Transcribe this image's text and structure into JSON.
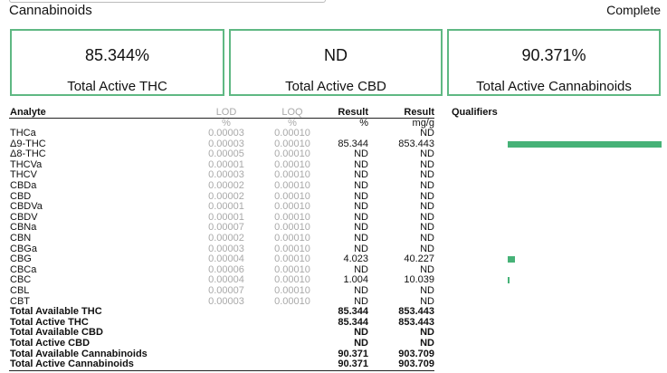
{
  "section_title": "Cannabinoids",
  "status": "Complete",
  "cards": [
    {
      "value": "85.344%",
      "caption": "Total Active THC"
    },
    {
      "value": "ND",
      "caption": "Total Active CBD"
    },
    {
      "value": "90.371%",
      "caption": "Total Active Cannabinoids"
    }
  ],
  "table": {
    "headers": {
      "analyte": "Analyte",
      "lod": "LOD",
      "loq": "LOQ",
      "result_pct": "Result",
      "result_mg": "Result",
      "qualifiers": "Qualifiers"
    },
    "units": {
      "lod": "%",
      "loq": "%",
      "result_pct": "%",
      "result_mg": "mg/g"
    },
    "rows": [
      {
        "analyte": "THCa",
        "lod": "0.00003",
        "loq": "0.00010",
        "pct": "",
        "mg": "ND",
        "bar": 0
      },
      {
        "analyte": "Δ9-THC",
        "lod": "0.00003",
        "loq": "0.00010",
        "pct": "85.344",
        "mg": "853.443",
        "bar": 85.344
      },
      {
        "analyte": "Δ8-THC",
        "lod": "0.00005",
        "loq": "0.00010",
        "pct": "ND",
        "mg": "ND",
        "bar": 0
      },
      {
        "analyte": "THCVa",
        "lod": "0.00001",
        "loq": "0.00010",
        "pct": "ND",
        "mg": "ND",
        "bar": 0
      },
      {
        "analyte": "THCV",
        "lod": "0.00003",
        "loq": "0.00010",
        "pct": "ND",
        "mg": "ND",
        "bar": 0
      },
      {
        "analyte": "CBDa",
        "lod": "0.00002",
        "loq": "0.00010",
        "pct": "ND",
        "mg": "ND",
        "bar": 0
      },
      {
        "analyte": "CBD",
        "lod": "0.00002",
        "loq": "0.00010",
        "pct": "ND",
        "mg": "ND",
        "bar": 0
      },
      {
        "analyte": "CBDVa",
        "lod": "0.00001",
        "loq": "0.00010",
        "pct": "ND",
        "mg": "ND",
        "bar": 0
      },
      {
        "analyte": "CBDV",
        "lod": "0.00001",
        "loq": "0.00010",
        "pct": "ND",
        "mg": "ND",
        "bar": 0
      },
      {
        "analyte": "CBNa",
        "lod": "0.00007",
        "loq": "0.00010",
        "pct": "ND",
        "mg": "ND",
        "bar": 0
      },
      {
        "analyte": "CBN",
        "lod": "0.00002",
        "loq": "0.00010",
        "pct": "ND",
        "mg": "ND",
        "bar": 0
      },
      {
        "analyte": "CBGa",
        "lod": "0.00003",
        "loq": "0.00010",
        "pct": "ND",
        "mg": "ND",
        "bar": 0
      },
      {
        "analyte": "CBG",
        "lod": "0.00004",
        "loq": "0.00010",
        "pct": "4.023",
        "mg": "40.227",
        "bar": 4.023
      },
      {
        "analyte": "CBCa",
        "lod": "0.00006",
        "loq": "0.00010",
        "pct": "ND",
        "mg": "ND",
        "bar": 0
      },
      {
        "analyte": "CBC",
        "lod": "0.00004",
        "loq": "0.00010",
        "pct": "1.004",
        "mg": "10.039",
        "bar": 1.004
      },
      {
        "analyte": "CBL",
        "lod": "0.00007",
        "loq": "0.00010",
        "pct": "ND",
        "mg": "ND",
        "bar": 0
      },
      {
        "analyte": "CBT",
        "lod": "0.00003",
        "loq": "0.00010",
        "pct": "ND",
        "mg": "ND",
        "bar": 0
      }
    ],
    "totals": [
      {
        "analyte": "Total Available THC",
        "pct": "85.344",
        "mg": "853.443"
      },
      {
        "analyte": "Total Active THC",
        "pct": "85.344",
        "mg": "853.443"
      },
      {
        "analyte": "Total Available CBD",
        "pct": "ND",
        "mg": "ND"
      },
      {
        "analyte": "Total Active CBD",
        "pct": "ND",
        "mg": "ND"
      },
      {
        "analyte": "Total Available Cannabinoids",
        "pct": "90.371",
        "mg": "903.709"
      },
      {
        "analyte": "Total Active Cannabinoids",
        "pct": "90.371",
        "mg": "903.709"
      }
    ]
  },
  "colors": {
    "accent": "#46b277",
    "card_border": "#5fb883"
  }
}
